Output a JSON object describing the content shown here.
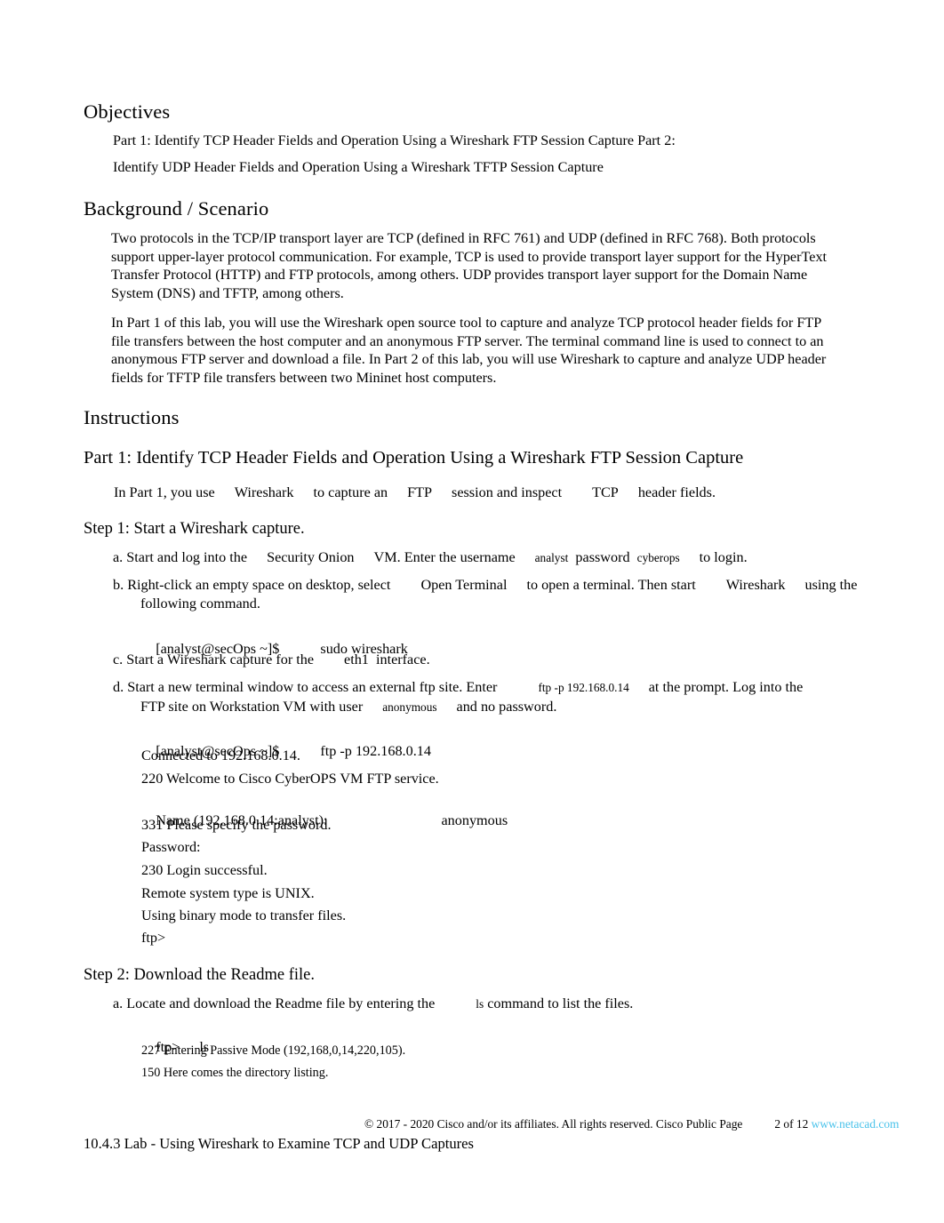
{
  "document": {
    "sections": {
      "objectives_heading": "Objectives",
      "objectives_line1": "Part 1: Identify TCP Header Fields and Operation Using a Wireshark FTP Session Capture Part 2:",
      "objectives_line2": "Identify UDP Header Fields and Operation Using a Wireshark TFTP Session Capture",
      "background_heading": "Background / Scenario",
      "background_p1": "Two protocols in the TCP/IP transport layer are TCP (defined in RFC 761) and UDP (defined in RFC 768). Both protocols support upper-layer protocol communication. For example, TCP is used to provide transport layer support for the HyperText Transfer Protocol (HTTP) and FTP protocols, among others. UDP provides transport layer support for the Domain Name System (DNS) and TFTP, among others.",
      "background_p2": "In Part 1 of this lab, you will use the Wireshark open source tool to capture and analyze TCP protocol header fields for FTP file transfers between the host computer and an anonymous FTP server. The terminal command line is used to connect to an anonymous FTP server and download a file. In Part 2 of this lab, you will use Wireshark to capture and analyze UDP header fields for TFTP file transfers between two Mininet host computers.",
      "instructions_heading": "Instructions",
      "part1_heading": "Part 1: Identify TCP Header Fields and Operation Using a Wireshark FTP Session Capture"
    },
    "part1_intro": {
      "t1": "In Part 1, you use",
      "t2": "Wireshark",
      "t3": "to capture an",
      "t4": "FTP",
      "t5": "session and inspect",
      "t6": "TCP",
      "t7": "header fields."
    },
    "step1": {
      "heading": "Step 1: Start a Wireshark capture.",
      "a": {
        "marker": "a.",
        "t1": "Start and log into the",
        "t2": "Security Onion",
        "t3": "VM. Enter the username",
        "t4": "analyst",
        "t5": "password",
        "t6": "cyberops",
        "t7": "to login."
      },
      "b": {
        "marker": "b.",
        "t1": "Right-click an empty space on desktop, select",
        "t2": "Open Terminal",
        "t3": "to open a terminal. Then start",
        "t4": "Wireshark",
        "t5": "using the",
        "t6": "following command."
      },
      "b_cmd_prompt": "[analyst@secOps ~]$",
      "b_cmd_text": "sudo wireshark",
      "c": {
        "marker": "c.",
        "t1": "Start a Wireshark capture for the",
        "t2": "eth1",
        "t3": "interface."
      },
      "d": {
        "marker": "d.",
        "t1": "Start a new terminal window to access an external ftp site. Enter",
        "t2": "ftp -p 192.168.0.14",
        "t3": "at the prompt. Log into the",
        "t4": "FTP site on Workstation VM with user",
        "t5": "anonymous",
        "t6": "and no password."
      },
      "d_cmd_prompt": "[analyst@secOps ~]$",
      "d_cmd_text": "ftp -p 192.168.0.14",
      "terminal_output": [
        "Connected to 192.168.0.14.",
        "220 Welcome to Cisco CyberOPS VM FTP service.",
        "331 Please specify the password.",
        "Password:",
        "230 Login successful.",
        "Remote system type is UNIX.",
        "Using binary mode to transfer files.",
        "ftp>"
      ],
      "name_prompt": "Name (192.168.0.14:analyst):",
      "name_value": "anonymous"
    },
    "step2": {
      "heading": "Step 2: Download the Readme file.",
      "a": {
        "marker": "a.",
        "t1": "Locate and download the Readme file by entering the",
        "t2": "ls",
        "t3": "command to list the files."
      },
      "cmd_prompt": "ftp>",
      "cmd_text": "ls",
      "out1": "227 Entering Passive Mode (192,168,0,14,220,105).",
      "out2": "150 Here comes the directory listing."
    },
    "footer": {
      "copyright": "© 2017 - 2020 Cisco and/or its affiliates. All rights reserved. Cisco Public Page",
      "page_number": "2 of 12",
      "url": "www.netacad.com",
      "doc_title": "10.4.3 Lab - Using Wireshark to Examine TCP and UDP Captures",
      "link_color": "#49C2EA"
    }
  }
}
